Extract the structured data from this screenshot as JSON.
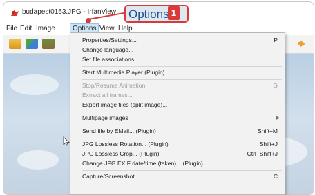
{
  "window": {
    "title": "budapest0153.JPG - IrfanView"
  },
  "menubar": {
    "items": [
      "File",
      "Edit",
      "Image",
      "Options",
      "View",
      "Help"
    ],
    "active": "Options"
  },
  "callout": {
    "text": "Options",
    "badge": "1",
    "accent": "#d83a3a"
  },
  "options_menu": {
    "items": [
      {
        "label": "Properties/Settings...",
        "shortcut": "P"
      },
      {
        "label": "Change language...",
        "shortcut": ""
      },
      {
        "label": "Set file associations...",
        "shortcut": ""
      },
      {
        "label": "Start Multimedia Player (Plugin)",
        "shortcut": ""
      },
      {
        "label": "Stop/Resume Animation",
        "shortcut": "G",
        "disabled": true
      },
      {
        "label": "Extract all frames...",
        "shortcut": "",
        "disabled": true
      },
      {
        "label": "Export image tiles (split image)...",
        "shortcut": ""
      },
      {
        "label": "Multipage images",
        "shortcut": "",
        "submenu": true
      },
      {
        "label": "Send file by EMail... (Plugin)",
        "shortcut": "Shift+M"
      },
      {
        "label": "JPG Lossless Rotation... (Plugin)",
        "shortcut": "Shift+J"
      },
      {
        "label": "JPG Lossless Crop... (Plugin)",
        "shortcut": "Ctrl+Shift+J"
      },
      {
        "label": "Change JPG EXIF date/time (taken)... (Plugin)",
        "shortcut": ""
      },
      {
        "label": "Capture/Screenshot...",
        "shortcut": "C"
      }
    ]
  },
  "icons": {
    "app": "irfanview-app-icon",
    "toolbar": [
      "open-folder-icon",
      "thumbnails-icon",
      "slideshow-icon",
      "next-file-icon"
    ],
    "cursor": "mouse-pointer-icon"
  }
}
